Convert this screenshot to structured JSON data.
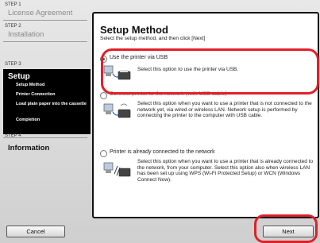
{
  "steps": [
    {
      "label": "STEP 1",
      "title": "License Agreement"
    },
    {
      "label": "STEP 2",
      "title": "Installation"
    },
    {
      "label": "STEP 3",
      "title": "Setup",
      "subitems": [
        "Setup Method",
        "Printer Connection",
        "Load plain paper into the cassette",
        "Completion"
      ]
    },
    {
      "label": "STEP 4",
      "title": "Information"
    }
  ],
  "panel": {
    "heading": "Setup Method",
    "instruction": "Select the setup method, and then click [Next]",
    "options": [
      {
        "label": "Use the printer via USB",
        "desc": "Select this option to use the printer via USB.",
        "selected": true
      },
      {
        "label": "Connect printer to the network (with USB cable)",
        "desc": "Select this option when you want to use a printer that is not connected to the network yet, via wired or wireless LAN. Network setup is performed by connecting the printer to the computer with USB cable.",
        "selected": false
      },
      {
        "label": "Printer is already connected to the network",
        "desc": "Select this option when you want to use a printer that is already connected to the network, from your computer. Select this option also when wireless LAN has been set up using WPS (Wi-Fi Protected Setup) or WCN (Windows Connect Now).",
        "selected": false
      }
    ]
  },
  "buttons": {
    "cancel": "Cancel",
    "next": "Next"
  },
  "colors": {
    "highlight": "#e0202a",
    "active_step_bg": "#000000"
  }
}
